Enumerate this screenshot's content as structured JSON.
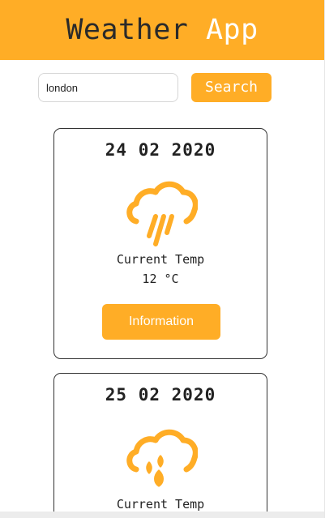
{
  "header": {
    "title_part1": "Weather",
    "title_part2": "App"
  },
  "search": {
    "value": "london",
    "button_label": "Search"
  },
  "forecast": [
    {
      "date": "24 02 2020",
      "icon": "cloud-rain-icon",
      "temp_label": "Current Temp",
      "temp_value": "12 °C",
      "button_label": "Information"
    },
    {
      "date": "25 02 2020",
      "icon": "cloud-drizzle-icon",
      "temp_label": "Current Temp"
    }
  ],
  "colors": {
    "accent": "#ffad26",
    "text": "#222222"
  }
}
